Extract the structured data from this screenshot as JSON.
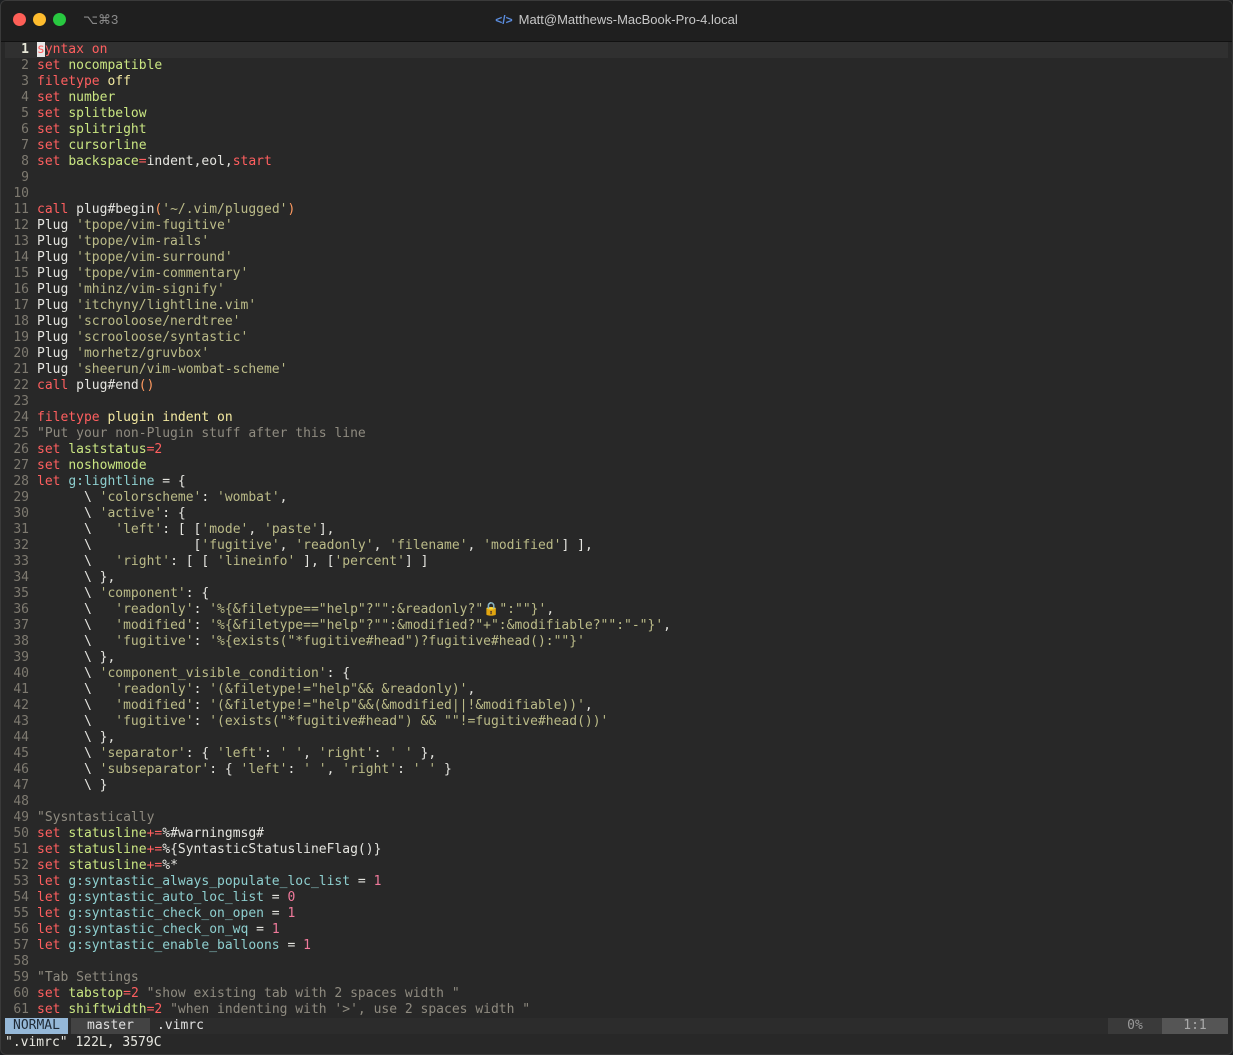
{
  "window": {
    "shortcut": "⌥⌘3",
    "title": "Matt@Matthews-MacBook-Pro-4.local",
    "title_icon": "</>"
  },
  "editor": {
    "lines": [
      "syntax on",
      "set nocompatible",
      "filetype off",
      "set number",
      "set splitbelow",
      "set splitright",
      "set cursorline",
      "set backspace=indent,eol,start",
      "",
      "",
      "call plug#begin('~/.vim/plugged')",
      "Plug 'tpope/vim-fugitive'",
      "Plug 'tpope/vim-rails'",
      "Plug 'tpope/vim-surround'",
      "Plug 'tpope/vim-commentary'",
      "Plug 'mhinz/vim-signify'",
      "Plug 'itchyny/lightline.vim'",
      "Plug 'scrooloose/nerdtree'",
      "Plug 'scrooloose/syntastic'",
      "Plug 'morhetz/gruvbox'",
      "Plug 'sheerun/vim-wombat-scheme'",
      "call plug#end()",
      "",
      "filetype plugin indent on",
      "\"Put your non-Plugin stuff after this line",
      "set laststatus=2",
      "set noshowmode",
      "let g:lightline = {",
      "      \\ 'colorscheme': 'wombat',",
      "      \\ 'active': {",
      "      \\   'left': [ ['mode', 'paste'],",
      "      \\             ['fugitive', 'readonly', 'filename', 'modified'] ],",
      "      \\   'right': [ [ 'lineinfo' ], ['percent'] ]",
      "      \\ },",
      "      \\ 'component': {",
      "      \\   'readonly': '%{&filetype==\"help\"?\"\":&readonly?\"🔒\":\"\"}',",
      "      \\   'modified': '%{&filetype==\"help\"?\"\":&modified?\"+\":&modifiable?\"\":\"-\"}',",
      "      \\   'fugitive': '%{exists(\"*fugitive#head\")?fugitive#head():\"\"}'",
      "      \\ },",
      "      \\ 'component_visible_condition': {",
      "      \\   'readonly': '(&filetype!=\"help\"&& &readonly)',",
      "      \\   'modified': '(&filetype!=\"help\"&&(&modified||!&modifiable))',",
      "      \\   'fugitive': '(exists(\"*fugitive#head\") && \"\"!=fugitive#head())'",
      "      \\ },",
      "      \\ 'separator': { 'left': ' ', 'right': ' ' },",
      "      \\ 'subseparator': { 'left': ' ', 'right': ' ' }",
      "      \\ }",
      "",
      "\"Sysntastically",
      "set statusline+=%#warningmsg#",
      "set statusline+=%{SyntasticStatuslineFlag()}",
      "set statusline+=%*",
      "let g:syntastic_always_populate_loc_list = 1",
      "let g:syntastic_auto_loc_list = 0",
      "let g:syntastic_check_on_open = 1",
      "let g:syntastic_check_on_wq = 1",
      "let g:syntastic_enable_balloons = 1",
      "",
      "\"Tab Settings",
      "set tabstop=2 \"show existing tab with 2 spaces width \"",
      "set shiftwidth=2 \"when indenting with '>', use 2 spaces width \""
    ]
  },
  "statusline": {
    "mode": "NORMAL",
    "branch": "master",
    "filename": ".vimrc",
    "percent": "0%",
    "position": "1:1"
  },
  "cmdline": {
    "message": "\".vimrc\" 122L, 3579C"
  },
  "colors": {
    "background": "#282828",
    "keyword": "#ff5f5f",
    "option": "#cae682",
    "string": "#bbbb88",
    "comment": "#8f8b80",
    "number": "#f07a9b",
    "mode_bg": "#95b8d8"
  }
}
